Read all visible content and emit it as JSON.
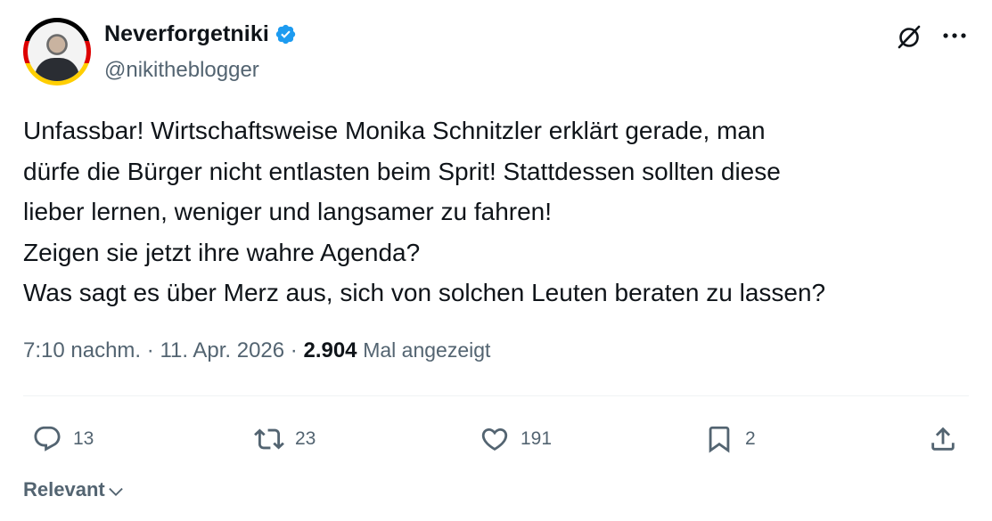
{
  "author": {
    "display_name": "Neverforgetniki",
    "handle": "@nikitheblogger",
    "verified": true
  },
  "icons": {
    "verified": "verified-badge-icon",
    "grok": "grok-icon",
    "more": "more-options-icon",
    "reply": "reply-icon",
    "retweet": "retweet-icon",
    "like": "heart-icon",
    "bookmark": "bookmark-icon",
    "share": "share-icon",
    "chevron": "chevron-down-icon"
  },
  "colors": {
    "text": "#0f1419",
    "secondary": "#536471",
    "verified": "#1d9bf0",
    "divider": "#eff3f4"
  },
  "tweet": {
    "lines": [
      "Unfassbar! Wirtschaftsweise Monika Schnitzler erklärt gerade, man",
      "dürfe die Bürger nicht entlasten beim Sprit! Stattdessen sollten diese",
      "lieber lernen, weniger und langsamer zu fahren!",
      "Zeigen sie jetzt ihre wahre Agenda?",
      "Was sagt es über Merz aus, sich von solchen Leuten beraten zu lassen?"
    ],
    "time": "7:10 nachm.",
    "separator": "·",
    "date": "11. Apr. 2026",
    "views_count": "2.904",
    "views_label": "Mal angezeigt"
  },
  "actions": {
    "replies": "13",
    "retweets": "23",
    "likes": "191",
    "bookmarks": "2"
  },
  "sort": {
    "label": "Relevant"
  }
}
